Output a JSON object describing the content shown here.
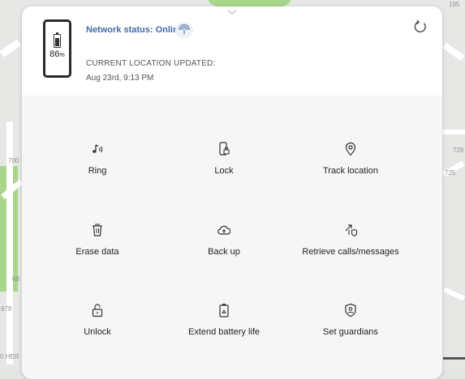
{
  "map": {
    "labels": [
      "195",
      "700",
      "729",
      "725",
      "68",
      "678",
      "0 HER"
    ]
  },
  "device": {
    "battery_percent": "86",
    "battery_unit": "%",
    "network_status": "Network status: Online",
    "location_title": "CURRENT LOCATION UPDATED:",
    "location_time": "Aug 23rd, 9:13 PM"
  },
  "actions": [
    {
      "label": "Ring",
      "icon": "ring-icon"
    },
    {
      "label": "Lock",
      "icon": "lock-phone-icon"
    },
    {
      "label": "Track location",
      "icon": "location-pin-icon"
    },
    {
      "label": "Erase data",
      "icon": "trash-icon"
    },
    {
      "label": "Back up",
      "icon": "cloud-upload-icon"
    },
    {
      "label": "Retrieve calls/messages",
      "icon": "retrieve-calls-icon"
    },
    {
      "label": "Unlock",
      "icon": "unlock-icon"
    },
    {
      "label": "Extend battery life",
      "icon": "battery-recycle-icon"
    },
    {
      "label": "Set guardians",
      "icon": "guardian-shield-icon"
    }
  ]
}
